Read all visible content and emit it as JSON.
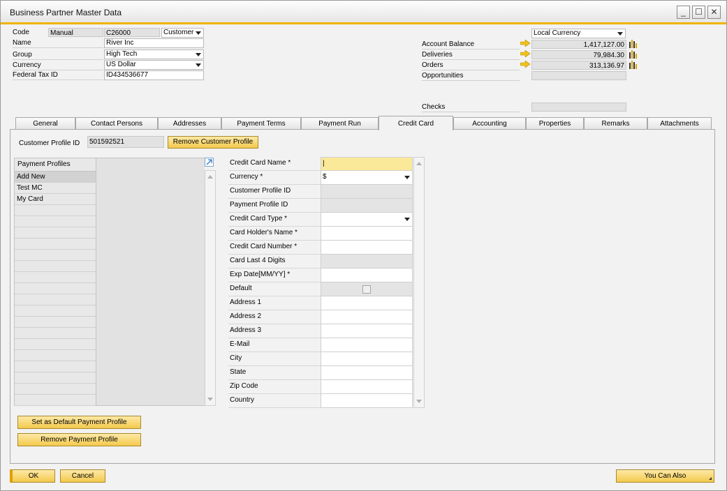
{
  "window": {
    "title": "Business Partner Master Data",
    "min": "‗",
    "max": "☐",
    "close": "✕"
  },
  "header": {
    "code_label": "Code",
    "code_series": "Manual",
    "code_value": "C26000",
    "code_type": "Customer",
    "name_label": "Name",
    "name_value": "River Inc",
    "group_label": "Group",
    "group_value": "High Tech",
    "currency_label": "Currency",
    "currency_value": "US Dollar",
    "taxid_label": "Federal Tax ID",
    "taxid_value": "ID434536677",
    "currency_display": "Local Currency",
    "account_balance_label": "Account Balance",
    "account_balance": "1,417,127.00",
    "deliveries_label": "Deliveries",
    "deliveries": "79,984.30",
    "orders_label": "Orders",
    "orders": "313,136.97",
    "opportunities_label": "Opportunities",
    "checks_label": "Checks"
  },
  "tabs": [
    "General",
    "Contact Persons",
    "Addresses",
    "Payment Terms",
    "Payment Run",
    "Credit Card",
    "Accounting",
    "Properties",
    "Remarks",
    "Attachments"
  ],
  "active_tab": "Credit Card",
  "credit_card": {
    "customer_profile_label": "Customer Profile ID",
    "customer_profile_value": "501592521",
    "remove_customer_profile": "Remove Customer Profile",
    "payment_profiles_header": "Payment Profiles",
    "profiles": [
      "Add New",
      "Test MC",
      "My Card"
    ],
    "fields": [
      {
        "label": "Credit Card Name *",
        "value": "|"
      },
      {
        "label": "Currency *",
        "value": "$"
      },
      {
        "label": "Customer Profile ID",
        "value": ""
      },
      {
        "label": "Payment Profile ID",
        "value": ""
      },
      {
        "label": "Credit Card Type *",
        "value": ""
      },
      {
        "label": "Card Holder's Name *",
        "value": ""
      },
      {
        "label": "Credit Card Number *",
        "value": ""
      },
      {
        "label": "Card Last 4 Digits",
        "value": ""
      },
      {
        "label": "Exp Date[MM/YY] *",
        "value": ""
      },
      {
        "label": "Default",
        "value": ""
      },
      {
        "label": "Address 1",
        "value": ""
      },
      {
        "label": "Address 2",
        "value": ""
      },
      {
        "label": "Address 3",
        "value": ""
      },
      {
        "label": "E-Mail",
        "value": ""
      },
      {
        "label": "City",
        "value": ""
      },
      {
        "label": "State",
        "value": ""
      },
      {
        "label": "Zip Code",
        "value": ""
      },
      {
        "label": "Country",
        "value": ""
      }
    ],
    "set_default_button": "Set as Default Payment Profile",
    "remove_payment_button": "Remove Payment Profile"
  },
  "footer": {
    "ok": "OK",
    "cancel": "Cancel",
    "you_can_also": "You Can Also"
  },
  "colors": {
    "accent": "#f0b400",
    "button_top": "#fde9a7",
    "button_bottom": "#f4c94c",
    "highlight_field": "#fbe99a"
  }
}
